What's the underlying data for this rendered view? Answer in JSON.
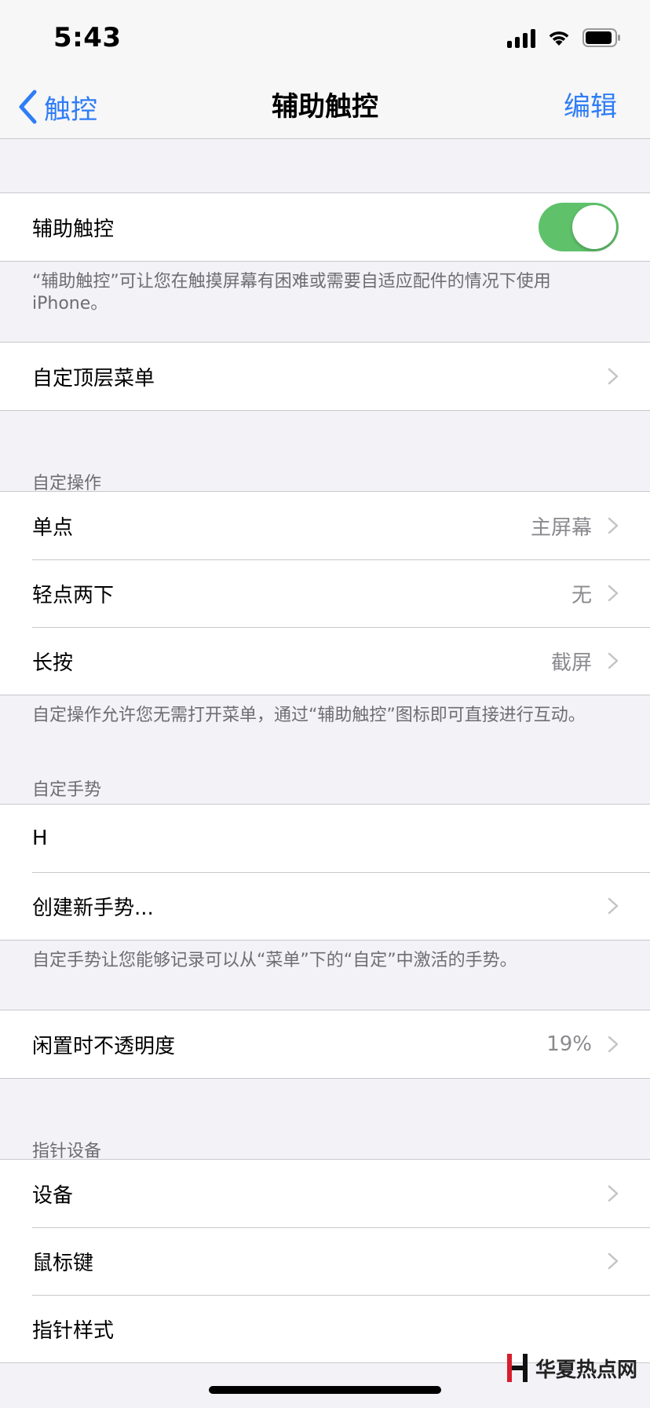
{
  "status_bar": {
    "time": "5:43"
  },
  "nav": {
    "back_label": "触控",
    "title": "辅助触控",
    "edit_label": "编辑",
    "accent_color": "#2f7df6"
  },
  "assistive_touch": {
    "label": "辅助触控",
    "enabled": true,
    "description": "“辅助触控”可让您在触摸屏幕有困难或需要自适应配件的情况下使用iPhone。"
  },
  "top_menu": {
    "label": "自定顶层菜单"
  },
  "custom_actions": {
    "header": "自定操作",
    "items": [
      {
        "label": "单点",
        "value": "主屏幕"
      },
      {
        "label": "轻点两下",
        "value": "无"
      },
      {
        "label": "长按",
        "value": "截屏"
      }
    ],
    "footer": "自定操作允许您无需打开菜单，通过“辅助触控”图标即可直接进行互动。"
  },
  "custom_gestures": {
    "header": "自定手势",
    "items": [
      {
        "label": "H"
      },
      {
        "label": "创建新手势..."
      }
    ],
    "footer": "自定手势让您能够记录可以从“菜单”下的“自定”中激活的手势。"
  },
  "idle_opacity": {
    "label": "闲置时不透明度",
    "value": "19%"
  },
  "pointer_devices": {
    "header": "指针设备",
    "items": [
      {
        "label": "设备"
      },
      {
        "label": "鼠标键"
      },
      {
        "label": "指针样式"
      }
    ]
  },
  "watermark": {
    "text": "华夏热点网"
  }
}
